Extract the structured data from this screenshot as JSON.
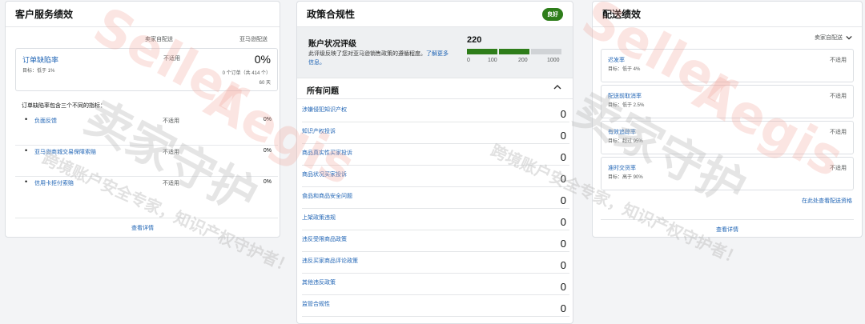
{
  "customer_service": {
    "title": "客户服务绩效",
    "col_seller": "卖家自配送",
    "col_amazon": "亚马逊配送",
    "odr": {
      "name": "订单缺陷率",
      "target": "目标：低于 1%",
      "seller_value": "不适用",
      "amazon_value": "0%",
      "orders_text": "0 个订单（共 414 个）",
      "days_text": "60 天"
    },
    "intro": "订单缺陷率包含三个不同的指标：",
    "metrics": [
      {
        "name": "负面反馈",
        "seller_value": "不适用",
        "amazon_value": "0%"
      },
      {
        "name": "亚马逊商城交易保障索赔",
        "seller_value": "不适用",
        "amazon_value": "0%"
      },
      {
        "name": "信用卡拒付索赔",
        "seller_value": "不适用",
        "amazon_value": "0%"
      }
    ],
    "view_details": "查看详情"
  },
  "policy": {
    "title": "政策合规性",
    "badge": "良好",
    "ahr_title": "账户状况评级",
    "ahr_desc_text": "此评级反映了您对亚马逊销售政策的遵循程度。",
    "ahr_desc_link": "了解更多信息。",
    "ahr_score": "220",
    "ahr_score_value": 220,
    "ahr_max": 1000,
    "ticks": [
      "0",
      "100",
      "200",
      "1000"
    ],
    "issues_title": "所有问题",
    "issues": [
      {
        "name": "涉嫌侵犯知识产权",
        "value": "0"
      },
      {
        "name": "知识产权投诉",
        "value": "0"
      },
      {
        "name": "商品真实性买家投诉",
        "value": "0"
      },
      {
        "name": "商品状况买家投诉",
        "value": "0"
      },
      {
        "name": "食品和商品安全问题",
        "value": "0"
      },
      {
        "name": "上架政策违规",
        "value": "0"
      },
      {
        "name": "违反受限商品政策",
        "value": "0"
      },
      {
        "name": "违反买家商品评论政策",
        "value": "0"
      },
      {
        "name": "其他违反政策",
        "value": "0"
      },
      {
        "name": "监管合规性",
        "value": "0"
      }
    ]
  },
  "shipping": {
    "title": "配送绩效",
    "filter_label": "卖家自配送",
    "metrics": [
      {
        "name": "迟发率",
        "target": "目标：低于 4%",
        "value": "不适用"
      },
      {
        "name": "配送前取消率",
        "target": "目标：低于 2.5%",
        "value": "不适用"
      },
      {
        "name": "有效追踪率",
        "target": "目标：超过 95%",
        "value": "不适用"
      },
      {
        "name": "准时交货率",
        "target": "目标：高于 90%",
        "value": "不适用"
      }
    ],
    "eligibility_link": "在此处查看配送资格",
    "view_details": "查看详情"
  },
  "watermark": {
    "brand_en_1": "Seller",
    "brand_en_2": "Aegis",
    "brand_cn": "卖家守护",
    "slogan": "跨境账户安全专家，知识产权守护者！"
  },
  "colors": {
    "accent_green": "#2e7d1a",
    "link_blue": "#1e63b4"
  }
}
